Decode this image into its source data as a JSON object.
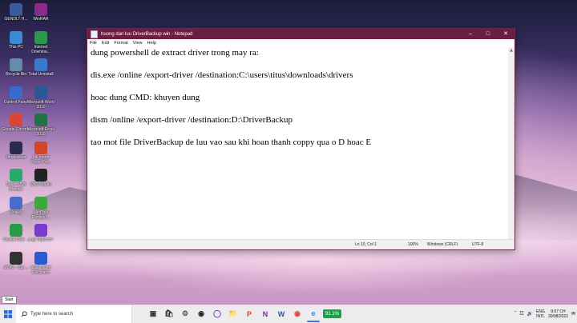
{
  "desktop": {
    "icons": [
      {
        "label": "GENDLT H...",
        "icon": "gen-icon",
        "color": "#3a5a9a"
      },
      {
        "label": "WinRAR",
        "icon": "winrar-icon",
        "color": "#8a2a8a"
      },
      {
        "label": "This PC",
        "icon": "this-pc-icon",
        "color": "#3a8ad4"
      },
      {
        "label": "Internet Downloa...",
        "icon": "idm-icon",
        "color": "#2a9a4a"
      },
      {
        "label": "Recycle Bin",
        "icon": "recycle-bin-icon",
        "color": "#6a8aaa"
      },
      {
        "label": "Total Uninstall",
        "icon": "total-uninstall-icon",
        "color": "#3a7acc"
      },
      {
        "label": "Control Panel",
        "icon": "control-panel-icon",
        "color": "#3a6acc"
      },
      {
        "label": "Microsoft Word 2010",
        "icon": "word-icon",
        "color": "#2b579a"
      },
      {
        "label": "Google Chrome",
        "icon": "chrome-icon",
        "color": "#db4437"
      },
      {
        "label": "Microsoft Excel 2010",
        "icon": "excel-icon",
        "color": "#217346"
      },
      {
        "label": "Ultraviewer",
        "icon": "ultraviewer-icon",
        "color": "#2a2a4a"
      },
      {
        "label": "Microsoft PowerPoi...",
        "icon": "powerpoint-icon",
        "color": "#d24726"
      },
      {
        "label": "Smart USB Booster",
        "icon": "smart-usb-icon",
        "color": "#2aaa6a"
      },
      {
        "label": "OBS Studio",
        "icon": "obs-icon",
        "color": "#222"
      },
      {
        "label": "Unikey",
        "icon": "unikey-icon",
        "color": "#4a6acc"
      },
      {
        "label": "MiniTool Partition...",
        "icon": "minitool-icon",
        "color": "#3aaa3a"
      },
      {
        "label": "Crystal Disk ...",
        "icon": "crystaldisk-icon",
        "color": "#2a9a4a"
      },
      {
        "label": "Logi Options+",
        "icon": "logi-icon",
        "color": "#7a3acc"
      },
      {
        "label": "GTAV - Cut ...",
        "icon": "gta-icon",
        "color": "#333"
      },
      {
        "label": "aCalculator Calculator",
        "icon": "calculator-icon",
        "color": "#2a5acc"
      }
    ]
  },
  "notepad": {
    "title": "huong dan luu DriverBackup win - Notepad",
    "menu": [
      "File",
      "Edit",
      "Format",
      "View",
      "Help"
    ],
    "lines": [
      "dung powershell de extract driver trong may ra:",
      "dis.exe /online /export-driver /destination:C:\\users\\titus\\downloads\\drivers",
      "hoac dung CMD: khuyen dung",
      "dism /online /export-driver /destination:D:\\DriverBackup",
      "tao mot file DriverBackup de luu vao sau khi hoan thanh coppy qua o D hoac E"
    ],
    "status": {
      "position": "Ln 10, Col 1",
      "zoom": "100%",
      "line_ending": "Windows (CRLF)",
      "encoding": "UTF-8"
    }
  },
  "taskbar": {
    "start_tooltip": "Start",
    "search_placeholder": "Type here to search",
    "apps": [
      "task-view-icon",
      "store-icon",
      "settings-icon",
      "obs-taskbar-icon",
      "logi-taskbar-icon",
      "explorer-icon",
      "powerpoint-taskbar-icon",
      "onenote-icon",
      "word-taskbar-icon",
      "chrome-taskbar-icon",
      "edge-icon"
    ],
    "battery": "91.1%",
    "lang_top": "ENG",
    "lang_bottom": "INTL",
    "time": "9:07 CH",
    "date": "30/08/2022"
  }
}
